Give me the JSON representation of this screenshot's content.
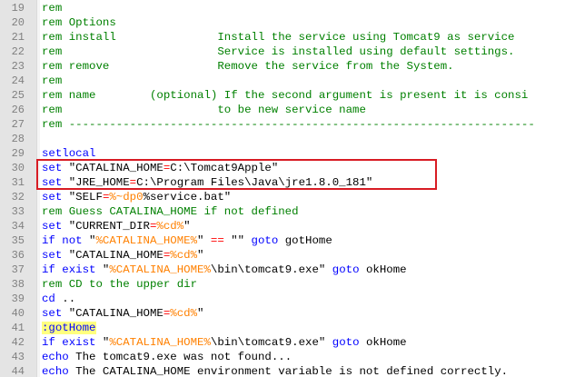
{
  "editor": {
    "lines": [
      {
        "num": "19",
        "segments": [
          {
            "c": "cm",
            "t": "rem"
          }
        ]
      },
      {
        "num": "20",
        "segments": [
          {
            "c": "cm",
            "t": "rem Options"
          }
        ]
      },
      {
        "num": "21",
        "segments": [
          {
            "c": "cm",
            "t": "rem install               Install the service using Tomcat9 as service"
          }
        ]
      },
      {
        "num": "22",
        "segments": [
          {
            "c": "cm",
            "t": "rem                       Service is installed using default settings."
          }
        ]
      },
      {
        "num": "23",
        "segments": [
          {
            "c": "cm",
            "t": "rem remove                Remove the service from the System."
          }
        ]
      },
      {
        "num": "24",
        "segments": [
          {
            "c": "cm",
            "t": "rem"
          }
        ]
      },
      {
        "num": "25",
        "segments": [
          {
            "c": "cm",
            "t": "rem name        (optional) If the second argument is present it is consi"
          }
        ]
      },
      {
        "num": "26",
        "segments": [
          {
            "c": "cm",
            "t": "rem                       to be new service name"
          }
        ]
      },
      {
        "num": "27",
        "segments": [
          {
            "c": "cm",
            "t": "rem ---------------------------------------------------------------------"
          }
        ]
      },
      {
        "num": "28",
        "segments": []
      },
      {
        "num": "29",
        "segments": [
          {
            "c": "kw",
            "t": "setlocal"
          }
        ]
      },
      {
        "num": "30",
        "segments": [
          {
            "c": "kw",
            "t": "set"
          },
          {
            "c": "",
            "t": " \"CATALINA_HOME"
          },
          {
            "c": "op",
            "t": "="
          },
          {
            "c": "",
            "t": "C:\\Tomcat9Apple\""
          }
        ]
      },
      {
        "num": "31",
        "segments": [
          {
            "c": "kw",
            "t": "set"
          },
          {
            "c": "",
            "t": " \"JRE_HOME"
          },
          {
            "c": "op",
            "t": "="
          },
          {
            "c": "",
            "t": "C:\\Program Files\\Java\\jre1.8.0_181\""
          }
        ]
      },
      {
        "num": "32",
        "segments": [
          {
            "c": "kw",
            "t": "set"
          },
          {
            "c": "",
            "t": " \"SELF"
          },
          {
            "c": "op",
            "t": "="
          },
          {
            "c": "var",
            "t": "%~dp0"
          },
          {
            "c": "",
            "t": "%service.bat\""
          }
        ]
      },
      {
        "num": "33",
        "segments": [
          {
            "c": "cm",
            "t": "rem Guess CATALINA_HOME if not defined"
          }
        ]
      },
      {
        "num": "34",
        "segments": [
          {
            "c": "kw",
            "t": "set"
          },
          {
            "c": "",
            "t": " \"CURRENT_DIR"
          },
          {
            "c": "op",
            "t": "="
          },
          {
            "c": "var",
            "t": "%cd%"
          },
          {
            "c": "",
            "t": "\""
          }
        ]
      },
      {
        "num": "35",
        "segments": [
          {
            "c": "kw",
            "t": "if not"
          },
          {
            "c": "",
            "t": " \""
          },
          {
            "c": "var",
            "t": "%CATALINA_HOME%"
          },
          {
            "c": "",
            "t": "\" "
          },
          {
            "c": "op",
            "t": "=="
          },
          {
            "c": "",
            "t": " \"\" "
          },
          {
            "c": "kw",
            "t": "goto"
          },
          {
            "c": "",
            "t": " gotHome"
          }
        ]
      },
      {
        "num": "36",
        "segments": [
          {
            "c": "kw",
            "t": "set"
          },
          {
            "c": "",
            "t": " \"CATALINA_HOME"
          },
          {
            "c": "op",
            "t": "="
          },
          {
            "c": "var",
            "t": "%cd%"
          },
          {
            "c": "",
            "t": "\""
          }
        ]
      },
      {
        "num": "37",
        "segments": [
          {
            "c": "kw",
            "t": "if exist"
          },
          {
            "c": "",
            "t": " \""
          },
          {
            "c": "var",
            "t": "%CATALINA_HOME%"
          },
          {
            "c": "",
            "t": "\\bin\\tomcat9.exe\" "
          },
          {
            "c": "kw",
            "t": "goto"
          },
          {
            "c": "",
            "t": " okHome"
          }
        ]
      },
      {
        "num": "38",
        "segments": [
          {
            "c": "cm",
            "t": "rem CD to the upper dir"
          }
        ]
      },
      {
        "num": "39",
        "segments": [
          {
            "c": "kw",
            "t": "cd"
          },
          {
            "c": "",
            "t": " .."
          }
        ]
      },
      {
        "num": "40",
        "segments": [
          {
            "c": "kw",
            "t": "set"
          },
          {
            "c": "",
            "t": " \"CATALINA_HOME"
          },
          {
            "c": "op",
            "t": "="
          },
          {
            "c": "var",
            "t": "%cd%"
          },
          {
            "c": "",
            "t": "\""
          }
        ]
      },
      {
        "num": "41",
        "segments": [
          {
            "c": "lbl",
            "t": ":gotHome"
          }
        ]
      },
      {
        "num": "42",
        "segments": [
          {
            "c": "kw",
            "t": "if exist"
          },
          {
            "c": "",
            "t": " \""
          },
          {
            "c": "var",
            "t": "%CATALINA_HOME%"
          },
          {
            "c": "",
            "t": "\\bin\\tomcat9.exe\" "
          },
          {
            "c": "kw",
            "t": "goto"
          },
          {
            "c": "",
            "t": " okHome"
          }
        ]
      },
      {
        "num": "43",
        "segments": [
          {
            "c": "kw",
            "t": "echo"
          },
          {
            "c": "",
            "t": " The tomcat9.exe was not found..."
          }
        ]
      },
      {
        "num": "44",
        "segments": [
          {
            "c": "kw",
            "t": "echo"
          },
          {
            "c": "",
            "t": " The CATALINA_HOME environment variable is not defined correctly."
          }
        ]
      }
    ]
  },
  "colors": {
    "comment": "#008000",
    "keyword": "#0000ff",
    "operator": "#ff0000",
    "variable": "#ff8000",
    "label_bg": "#ffff80",
    "highlight_box": "#d81c24",
    "gutter_bg": "#e4e4e4",
    "line_number": "#808080"
  }
}
